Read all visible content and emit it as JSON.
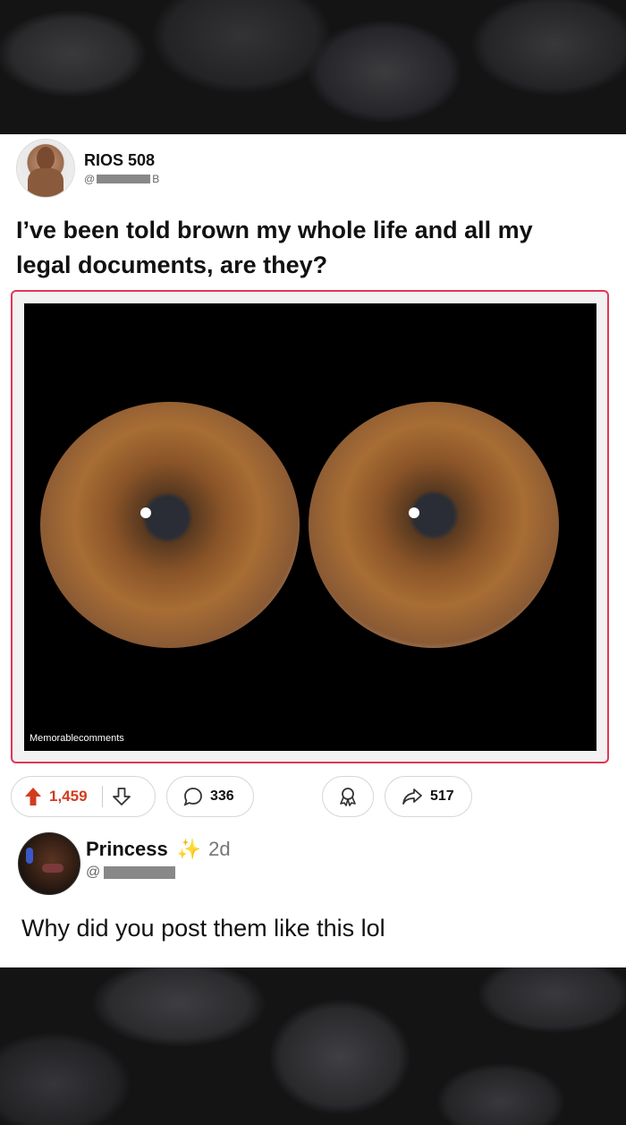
{
  "post": {
    "author": "RIOS 508",
    "handle_prefix": "@",
    "handle_suffix": "B",
    "title": "I’ve been told brown my whole life and all my legal documents, are they?",
    "media_watermark": "Memorablecomments"
  },
  "actions": {
    "upvotes": "1,459",
    "comments": "336",
    "shares": "517"
  },
  "comment": {
    "author": "Princess",
    "badge": "✨",
    "time": "2d",
    "handle_prefix": "@",
    "text": "Why did you post them like this lol"
  },
  "colors": {
    "media_border": "#e53555",
    "upvote": "#d23c1e"
  },
  "icons": [
    "upvote-arrow-icon",
    "downvote-arrow-icon",
    "comment-bubble-icon",
    "award-icon",
    "share-arrow-icon",
    "sparkle-icon"
  ]
}
